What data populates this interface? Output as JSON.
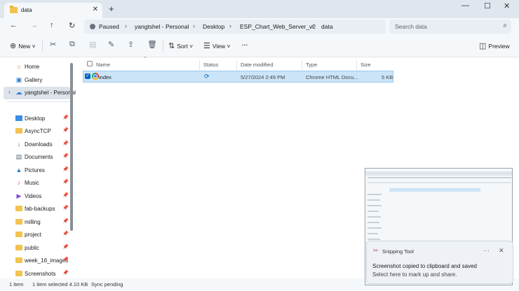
{
  "window": {
    "tab_title": "data",
    "new_tab_icon": "plus-icon",
    "controls": {
      "minimize": "—",
      "maximize": "☐",
      "close": "✕"
    }
  },
  "address": {
    "back": "←",
    "forward": "→",
    "up": "↑",
    "refresh": "↻",
    "status": "Paused",
    "breadcrumbs": [
      "yangtshel - Personal",
      "Desktop",
      "ESP_Chart_Web_Server_v2",
      "data"
    ],
    "search_placeholder": "Search data"
  },
  "toolbar": {
    "new_label": "New",
    "sort_label": "Sort",
    "view_label": "View",
    "more_label": "···",
    "preview_label": "Preview"
  },
  "sidebar": {
    "top": [
      {
        "label": "Home",
        "icon": "home-icon"
      },
      {
        "label": "Gallery",
        "icon": "gallery-icon"
      },
      {
        "label": "yangtshel - Personal",
        "icon": "onedrive-icon"
      }
    ],
    "pinned": [
      {
        "label": "Desktop",
        "icon": "desktop-icon"
      },
      {
        "label": "AsyncTCP",
        "icon": "folder-icon"
      },
      {
        "label": "Downloads",
        "icon": "download-icon"
      },
      {
        "label": "Documents",
        "icon": "documents-icon"
      },
      {
        "label": "Pictures",
        "icon": "pictures-icon"
      },
      {
        "label": "Music",
        "icon": "music-icon"
      },
      {
        "label": "Videos",
        "icon": "videos-icon"
      },
      {
        "label": "fab-backups",
        "icon": "folder-icon"
      },
      {
        "label": "milling",
        "icon": "folder-icon"
      },
      {
        "label": "project",
        "icon": "folder-icon"
      },
      {
        "label": "public",
        "icon": "folder-icon"
      },
      {
        "label": "week_16_images",
        "icon": "folder-icon"
      },
      {
        "label": "Screenshots",
        "icon": "folder-icon"
      }
    ]
  },
  "files": {
    "columns": {
      "name": "Name",
      "status": "Status",
      "date": "Date modified",
      "type": "Type",
      "size": "Size"
    },
    "rows": [
      {
        "name": "index",
        "status": "sync-pending-icon",
        "date": "5/27/2024 2:49 PM",
        "type": "Chrome HTML Docu...",
        "size": "5 KB"
      }
    ]
  },
  "statusbar": {
    "count": "1 item",
    "selection": "1 item selected  4.10 KB",
    "sync": "Sync pending"
  },
  "toast": {
    "app_name": "Snipping Tool",
    "more": "···",
    "close": "✕",
    "message": "Screenshot copied to clipboard and saved",
    "sub": "Select here to mark up and share."
  }
}
